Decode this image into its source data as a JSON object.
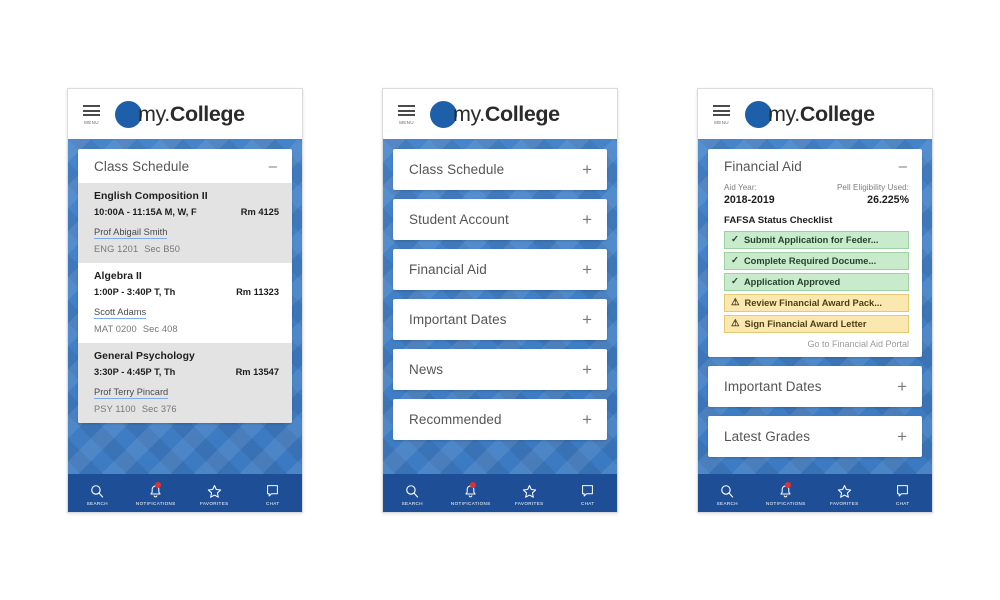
{
  "app": {
    "brand_light": "my.",
    "brand_bold": "College",
    "menu_label": "MENU",
    "menu_icon": "hamburger-icon",
    "logo_icon": "brand-dot-icon",
    "brand_color": "#1d5fa8",
    "body_bg_color": "#3d7ec9",
    "nav_bg_color": "#1d4e96",
    "badge_color": "#e03131"
  },
  "bottom_nav": {
    "items": [
      {
        "label": "SEARCH",
        "icon": "search-icon",
        "badge": false
      },
      {
        "label": "NOTIFICATIONS",
        "icon": "bell-icon",
        "badge": true
      },
      {
        "label": "FAVORITES",
        "icon": "star-icon",
        "badge": false
      },
      {
        "label": "CHAT",
        "icon": "chat-icon",
        "badge": false
      }
    ]
  },
  "screen_1": {
    "class_schedule": {
      "title": "Class Schedule",
      "toggle_sign": "–",
      "toggle_icon": "minus-icon",
      "classes": [
        {
          "name": "English Composition II",
          "time": "10:00A - 11:15A  M, W, F",
          "room": "Rm 4125",
          "professor": "Prof Abigail Smith",
          "course_code": "ENG 1201",
          "section": "Sec B50"
        },
        {
          "name": "Algebra II",
          "time": "1:00P - 3:40P T, Th",
          "room": "Rm 11323",
          "professor": "Scott Adams",
          "course_code": "MAT 0200",
          "section": "Sec 408"
        },
        {
          "name": "General Psychology",
          "time": "3:30P - 4:45P T, Th",
          "room": "Rm 13547",
          "professor": "Prof Terry Pincard",
          "course_code": "PSY 1100",
          "section": "Sec 376"
        }
      ]
    }
  },
  "screen_2": {
    "cards": [
      {
        "title": "Class Schedule",
        "sign": "+",
        "icon": "plus-icon"
      },
      {
        "title": "Student Account",
        "sign": "+",
        "icon": "plus-icon"
      },
      {
        "title": "Financial Aid",
        "sign": "+",
        "icon": "plus-icon"
      },
      {
        "title": "Important Dates",
        "sign": "+",
        "icon": "plus-icon"
      },
      {
        "title": "News",
        "sign": "+",
        "icon": "plus-icon"
      },
      {
        "title": "Recommended",
        "sign": "+",
        "icon": "plus-icon"
      }
    ]
  },
  "screen_3": {
    "financial_aid": {
      "title": "Financial Aid",
      "toggle_sign": "–",
      "toggle_icon": "minus-icon",
      "aid_year_label": "Aid Year:",
      "aid_year_value": "2018-2019",
      "pell_label": "Pell Eligibility Used:",
      "pell_value": "26.225%",
      "checklist_title": "FAFSA Status Checklist",
      "checklist": [
        {
          "label": "Submit Application for Feder...",
          "status": "done",
          "icon": "check-icon"
        },
        {
          "label": "Complete Required Docume...",
          "status": "done",
          "icon": "check-icon"
        },
        {
          "label": "Application Approved",
          "status": "done",
          "icon": "check-icon"
        },
        {
          "label": "Review Financial Award Pack...",
          "status": "pending",
          "icon": "warning-icon"
        },
        {
          "label": "Sign Financial Award Letter",
          "status": "pending",
          "icon": "warning-icon"
        }
      ],
      "portal_link": "Go to Financial Aid Portal"
    },
    "cards": [
      {
        "title": "Important Dates",
        "sign": "+",
        "icon": "plus-icon"
      },
      {
        "title": "Latest Grades",
        "sign": "+",
        "icon": "plus-icon"
      }
    ]
  }
}
